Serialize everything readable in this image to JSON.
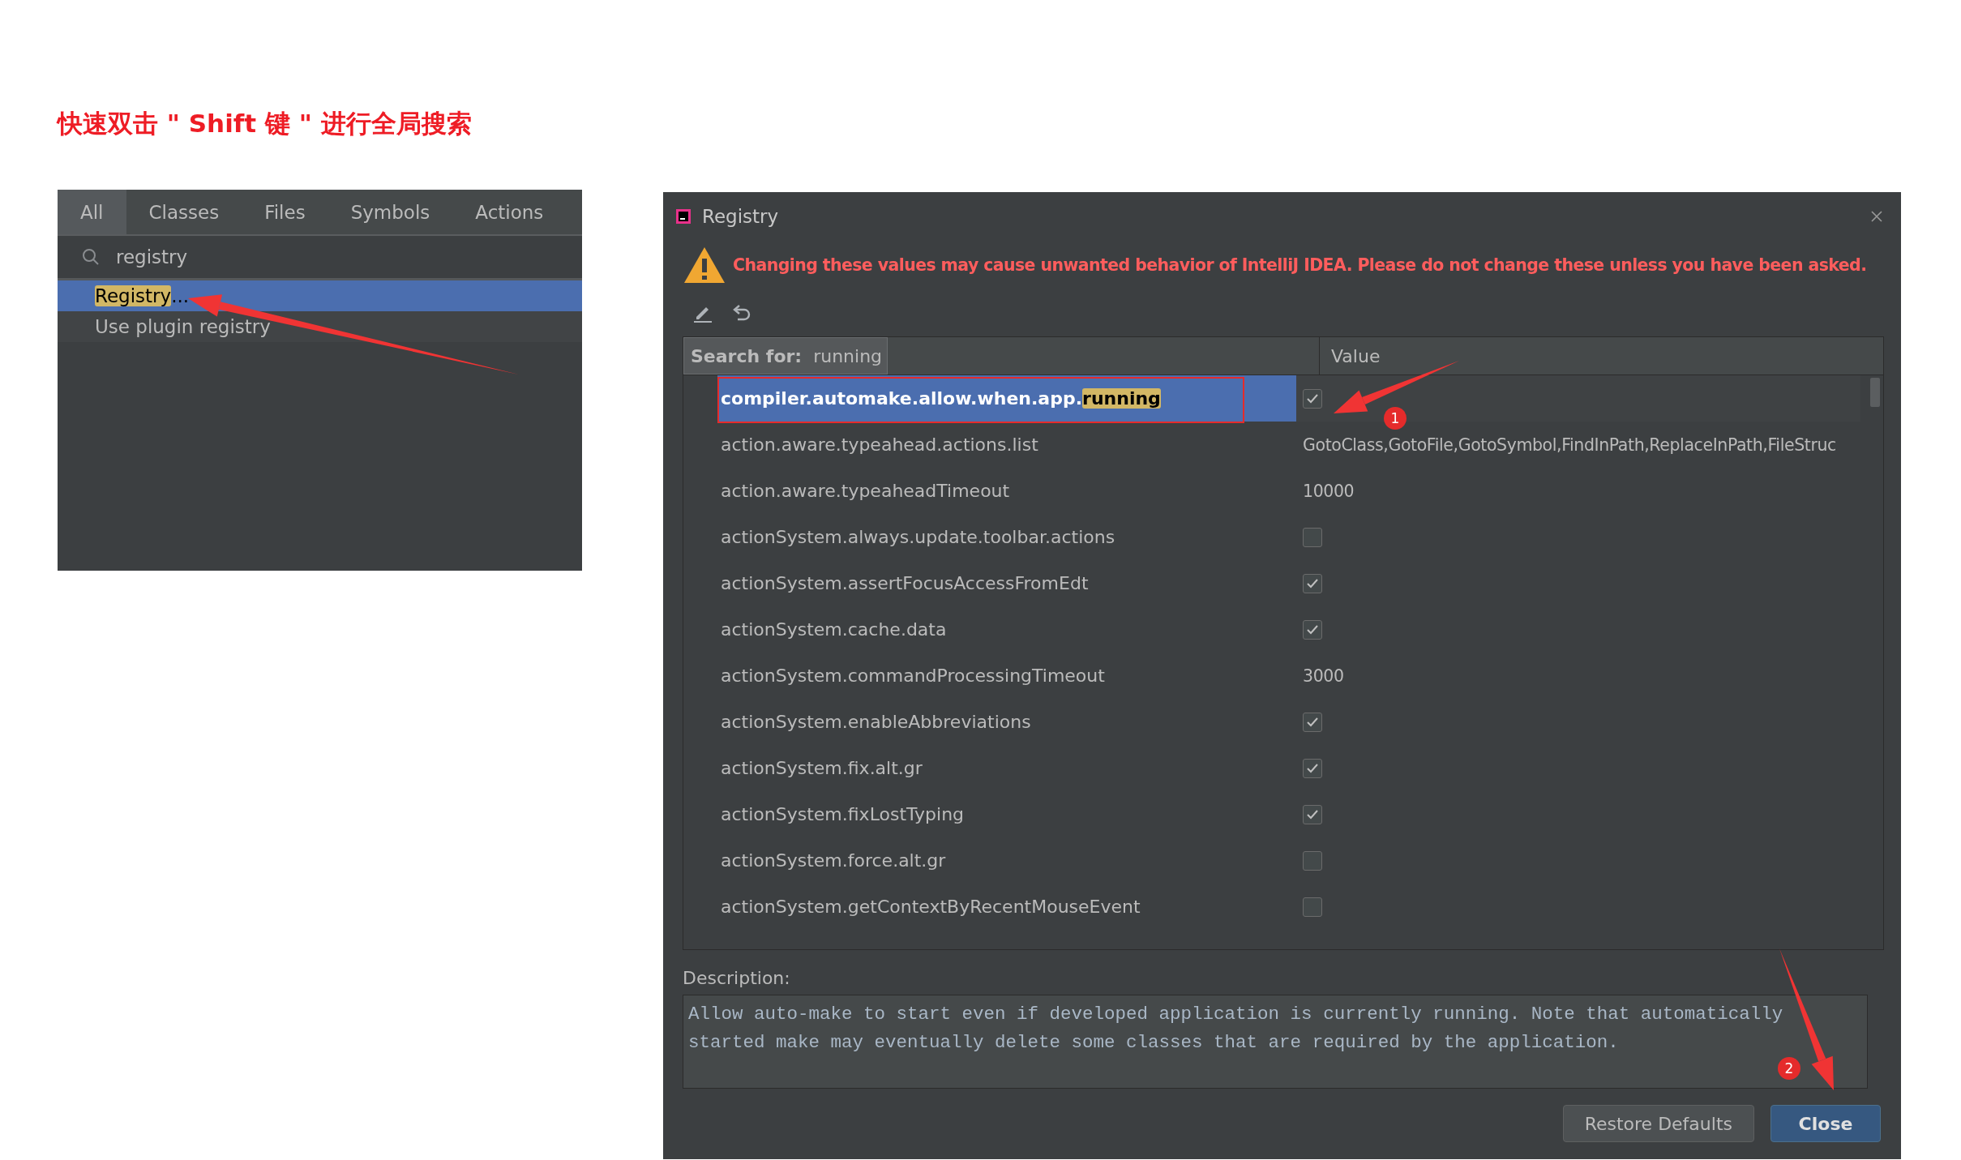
{
  "heading": "快速双击 \" Shift 键 \" 进行全局搜索",
  "search_popup": {
    "tabs": [
      {
        "label": "All",
        "selected": true
      },
      {
        "label": "Classes",
        "selected": false
      },
      {
        "label": "Files",
        "selected": false
      },
      {
        "label": "Symbols",
        "selected": false
      },
      {
        "label": "Actions",
        "selected": false
      }
    ],
    "query": "registry",
    "results": [
      {
        "selected": true,
        "parts": [
          {
            "text": "Registry",
            "match": true
          },
          {
            "text": "...",
            "match": false
          }
        ]
      },
      {
        "selected": false,
        "parts": [
          {
            "text": "Use plugin registry",
            "match": false
          }
        ]
      }
    ]
  },
  "dialog": {
    "title": "Registry",
    "warning": "Changing these values may cause unwanted behavior of IntelliJ IDEA. Please do not change these unless you have been asked.",
    "search_label": "Search for:",
    "search_text": "running",
    "value_header": "Value",
    "rows": [
      {
        "selected": true,
        "kind": "checkbox",
        "checked": true,
        "parts": [
          {
            "text": "compiler.automake.allow.when.app.",
            "match": false
          },
          {
            "text": "running",
            "match": true
          }
        ]
      },
      {
        "selected": false,
        "kind": "text",
        "value": "GotoClass,GotoFile,GotoSymbol,FindInPath,ReplaceInPath,FileStruc",
        "parts": [
          {
            "text": "action.aware.typeahead.actions.list",
            "match": false
          }
        ]
      },
      {
        "selected": false,
        "kind": "text",
        "value": "10000",
        "parts": [
          {
            "text": "action.aware.typeaheadTimeout",
            "match": false
          }
        ]
      },
      {
        "selected": false,
        "kind": "checkbox",
        "checked": false,
        "parts": [
          {
            "text": "actionSystem.always.update.toolbar.actions",
            "match": false
          }
        ]
      },
      {
        "selected": false,
        "kind": "checkbox",
        "checked": true,
        "parts": [
          {
            "text": "actionSystem.assertFocusAccessFromEdt",
            "match": false
          }
        ]
      },
      {
        "selected": false,
        "kind": "checkbox",
        "checked": true,
        "parts": [
          {
            "text": "actionSystem.cache.data",
            "match": false
          }
        ]
      },
      {
        "selected": false,
        "kind": "text",
        "value": "3000",
        "parts": [
          {
            "text": "actionSystem.commandProcessingTimeout",
            "match": false
          }
        ]
      },
      {
        "selected": false,
        "kind": "checkbox",
        "checked": true,
        "parts": [
          {
            "text": "actionSystem.enableAbbreviations",
            "match": false
          }
        ]
      },
      {
        "selected": false,
        "kind": "checkbox",
        "checked": true,
        "parts": [
          {
            "text": "actionSystem.fix.alt.gr",
            "match": false
          }
        ]
      },
      {
        "selected": false,
        "kind": "checkbox",
        "checked": true,
        "parts": [
          {
            "text": "actionSystem.fixLostTyping",
            "match": false
          }
        ]
      },
      {
        "selected": false,
        "kind": "checkbox",
        "checked": false,
        "parts": [
          {
            "text": "actionSystem.force.alt.gr",
            "match": false
          }
        ]
      },
      {
        "selected": false,
        "kind": "checkbox",
        "checked": false,
        "parts": [
          {
            "text": "actionSystem.getContextByRecentMouseEvent",
            "match": false
          }
        ]
      }
    ],
    "description_label": "Description:",
    "description": "Allow auto-make to start even if developed application is currently running. Note that automatically started make may eventually delete some classes that are required by the application.",
    "buttons": [
      {
        "label": "Restore Defaults",
        "kind": "default"
      },
      {
        "label": "Close",
        "kind": "primary"
      }
    ]
  },
  "annotations": [
    {
      "number": "1"
    },
    {
      "number": "2"
    }
  ]
}
